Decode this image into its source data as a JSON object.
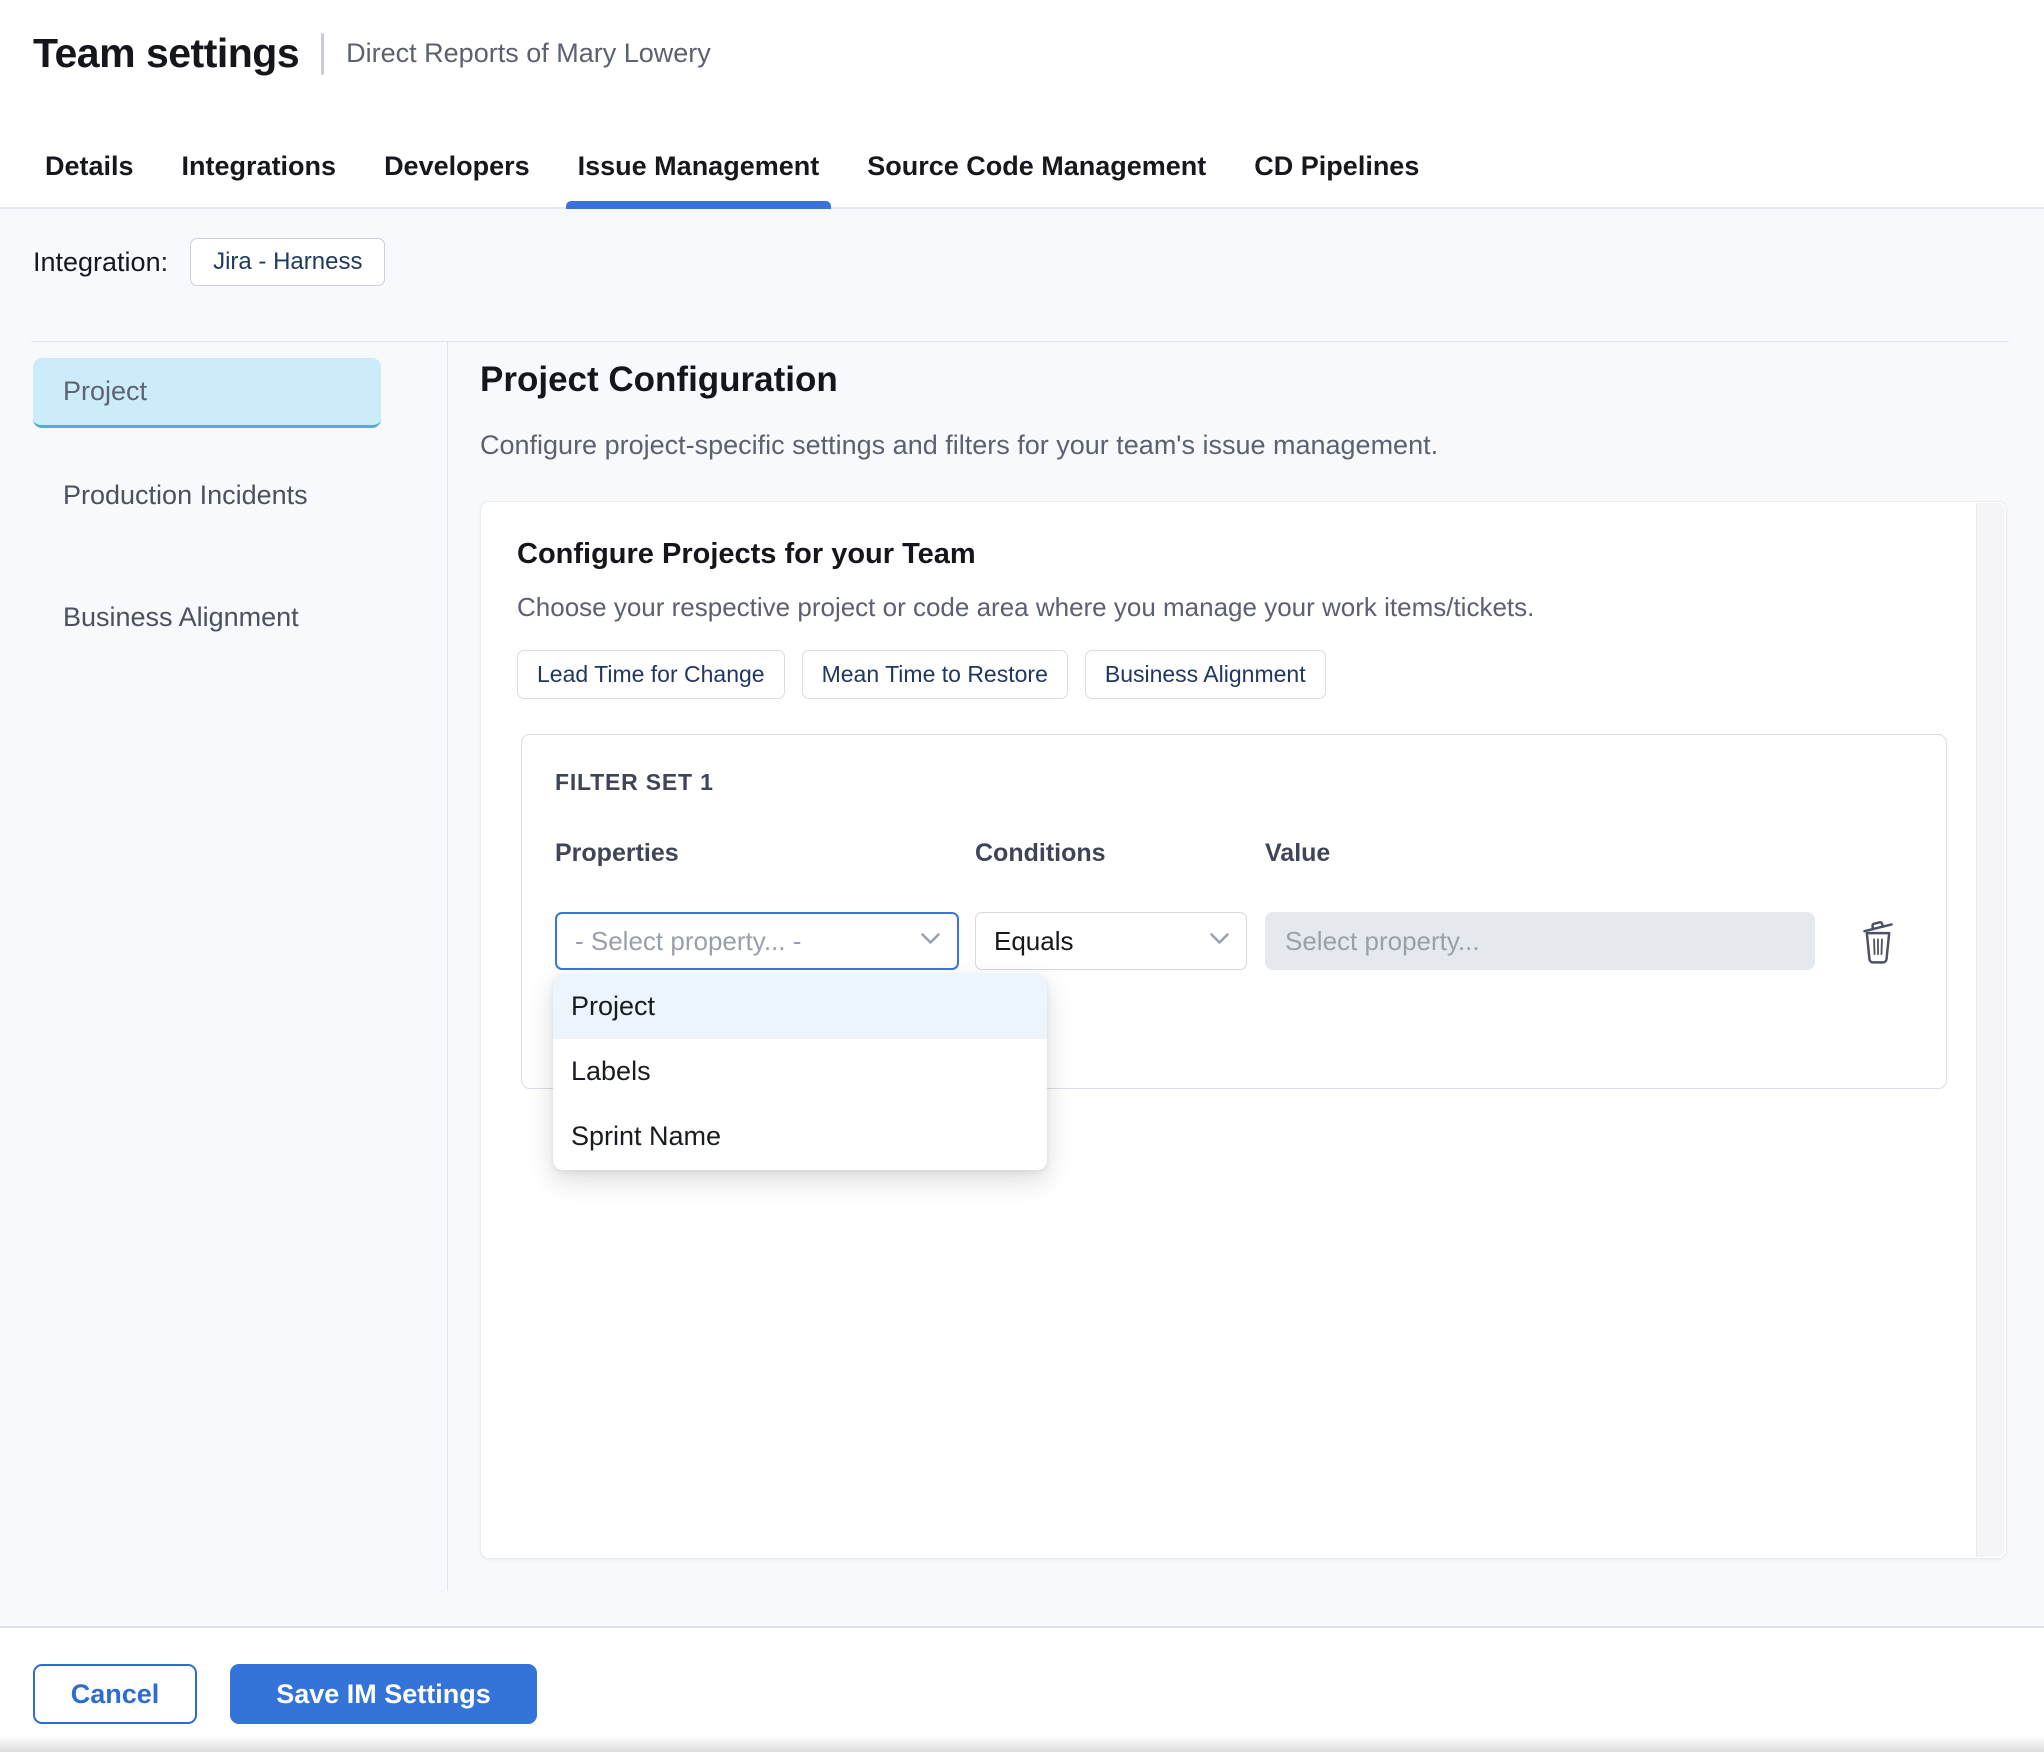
{
  "header": {
    "title": "Team settings",
    "subtitle": "Direct Reports of Mary Lowery"
  },
  "tabs": {
    "items": [
      {
        "label": "Details",
        "active": false
      },
      {
        "label": "Integrations",
        "active": false
      },
      {
        "label": "Developers",
        "active": false
      },
      {
        "label": "Issue Management",
        "active": true
      },
      {
        "label": "Source Code Management",
        "active": false
      },
      {
        "label": "CD Pipelines",
        "active": false
      }
    ]
  },
  "integration": {
    "label": "Integration:",
    "value": "Jira - Harness"
  },
  "sidebar": {
    "items": [
      {
        "label": "Project",
        "active": true
      },
      {
        "label": "Production Incidents",
        "active": false
      },
      {
        "label": "Business Alignment",
        "active": false
      }
    ]
  },
  "main": {
    "title": "Project Configuration",
    "description": "Configure project-specific settings and filters for your team's issue management.",
    "card": {
      "title": "Configure Projects for your Team",
      "description": "Choose your respective project or code area where you manage your work items/tickets.",
      "chips": [
        {
          "label": "Lead Time for Change"
        },
        {
          "label": "Mean Time to Restore"
        },
        {
          "label": "Business Alignment"
        }
      ],
      "filter_set": {
        "title": "FILTER SET 1",
        "columns": {
          "properties": "Properties",
          "conditions": "Conditions",
          "value": "Value"
        },
        "property_placeholder": "- Select property... -",
        "condition_value": "Equals",
        "value_placeholder": "Select property...",
        "dropdown": {
          "options": [
            {
              "label": "Project",
              "highlighted": true
            },
            {
              "label": "Labels",
              "highlighted": false
            },
            {
              "label": "Sprint Name",
              "highlighted": false
            }
          ]
        }
      }
    }
  },
  "footer": {
    "cancel_label": "Cancel",
    "save_label": "Save IM Settings"
  },
  "colors": {
    "accent_blue": "#3b72d9",
    "save_button": "#3473d8",
    "selected_sidebar_bg": "#cdecf9",
    "selected_sidebar_border": "#55add7",
    "dropdown_highlight": "#ecf5fb",
    "page_background": "#f8f9fc",
    "chip_text": "#21375f"
  }
}
